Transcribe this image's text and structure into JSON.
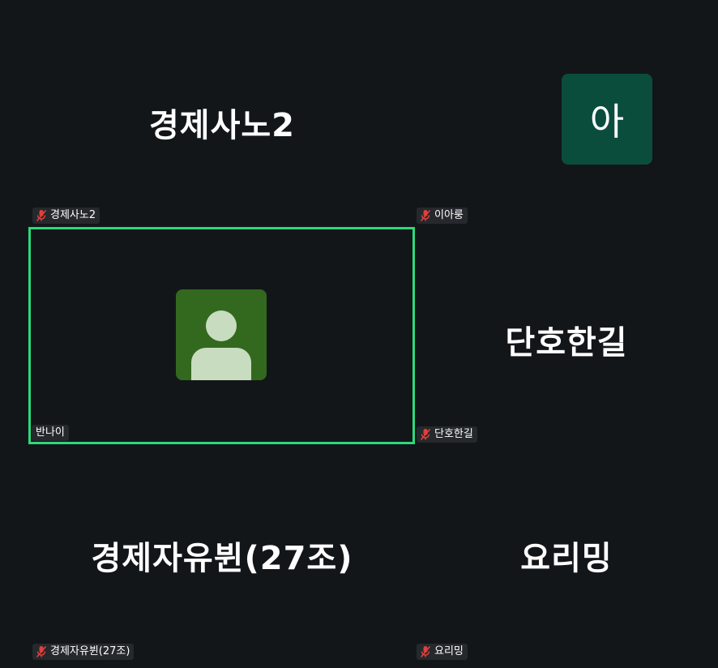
{
  "participants": [
    {
      "big_label": "경제사노2",
      "tag": "경제사노2",
      "muted": true
    },
    {
      "avatar_letter": "아",
      "tag": "이아룽",
      "muted": true,
      "avatar_color": "#0b4d3d"
    },
    {
      "tag": "반나이",
      "muted": false,
      "active_speaker": true,
      "avatar_color": "#33691e"
    },
    {
      "big_label": "단호한길",
      "tag": "단호한길",
      "muted": true
    },
    {
      "big_label": "경제자유뷘(27조)",
      "tag": "경제자유뷘(27조)",
      "muted": true
    },
    {
      "big_label": "요리밍",
      "tag": "요리밍",
      "muted": true
    }
  ],
  "colors": {
    "background": "#131619",
    "active_border": "#2bd97e",
    "mic_off": "#e0403c"
  },
  "icons": {
    "mic_off": "mic-off-icon",
    "default_avatar": "person-avatar-icon"
  }
}
